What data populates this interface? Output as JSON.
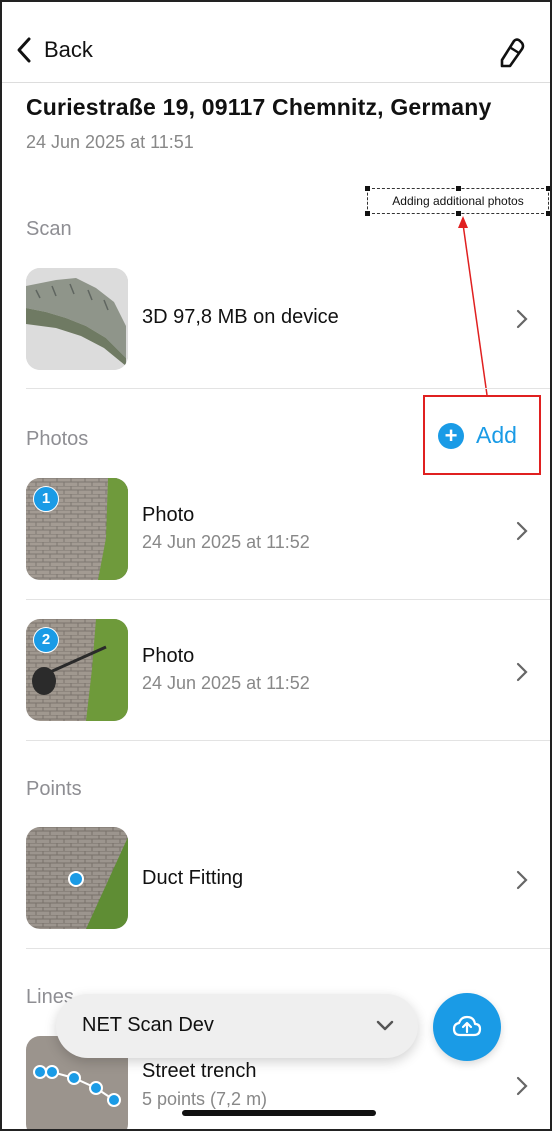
{
  "nav": {
    "back_label": "Back"
  },
  "header": {
    "title": "Curiestraße 19, 09117 Chemnitz, Germany",
    "subtitle": "24 Jun 2025 at 11:51"
  },
  "annotation": {
    "callout_text": "Adding additional photos"
  },
  "scan": {
    "section_label": "Scan",
    "item": {
      "title": "3D 97,8 MB on device"
    }
  },
  "photos": {
    "section_label": "Photos",
    "add_label": "Add",
    "items": [
      {
        "badge": "1",
        "title": "Photo",
        "subtitle": "24 Jun 2025 at 11:52"
      },
      {
        "badge": "2",
        "title": "Photo",
        "subtitle": "24 Jun 2025 at 11:52"
      }
    ]
  },
  "points": {
    "section_label": "Points",
    "items": [
      {
        "title": "Duct Fitting"
      }
    ]
  },
  "lines": {
    "section_label": "Lines",
    "items": [
      {
        "title": "Street trench",
        "subtitle": "5 points (7,2 m)"
      }
    ]
  },
  "bottom": {
    "project_selector": "NET Scan Dev"
  },
  "colors": {
    "accent": "#1a9be6",
    "highlight": "#e02020"
  }
}
